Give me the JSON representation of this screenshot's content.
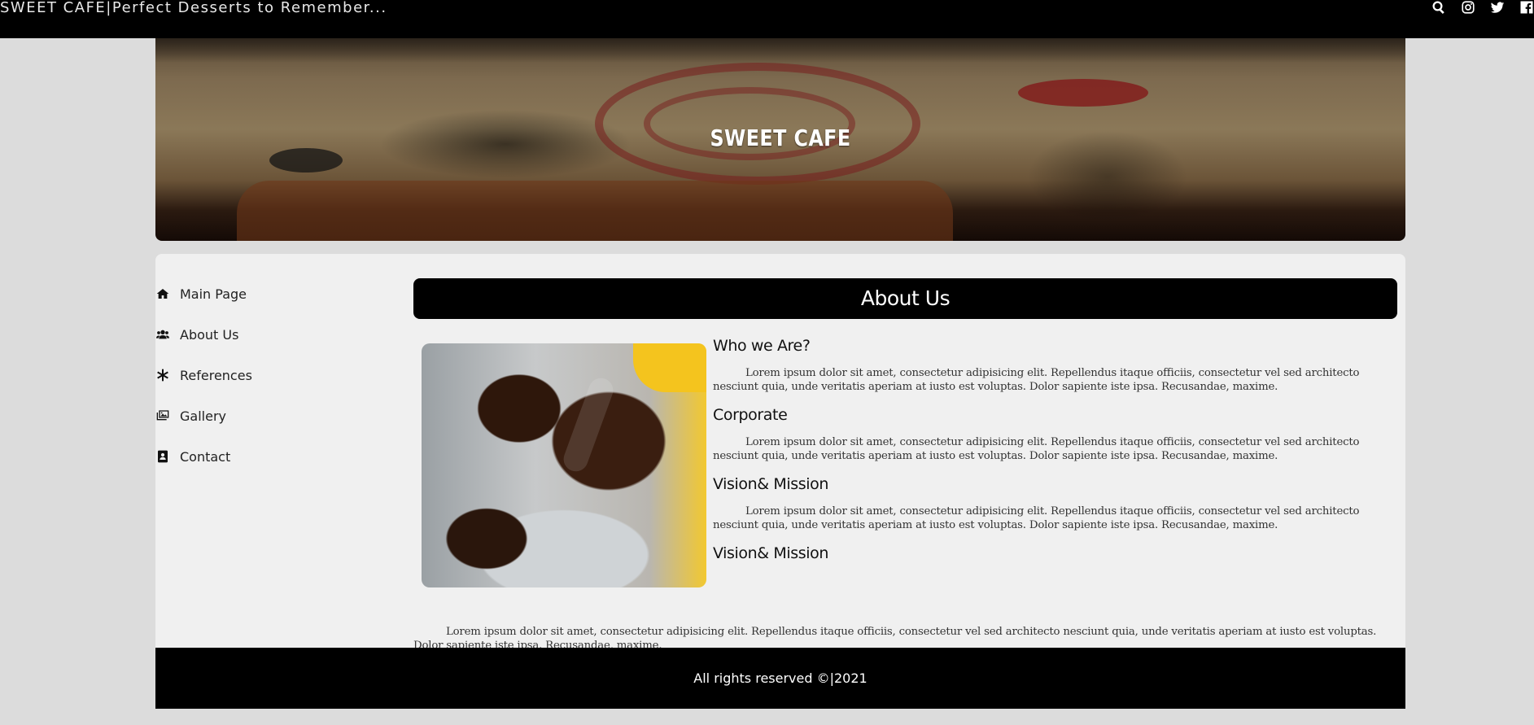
{
  "topbar": {
    "brand": "SWEET CAFE|Perfect Desserts to Remember...",
    "icons": [
      "search-icon",
      "instagram-icon",
      "twitter-icon",
      "facebook-icon"
    ]
  },
  "hero": {
    "title": "SWEET CAFE"
  },
  "nav": {
    "items": [
      {
        "label": "Main Page",
        "icon": "home-icon"
      },
      {
        "label": "About Us",
        "icon": "users-icon"
      },
      {
        "label": "References",
        "icon": "asterisk-icon"
      },
      {
        "label": "Gallery",
        "icon": "images-icon"
      },
      {
        "label": "Contact",
        "icon": "contact-card-icon"
      }
    ]
  },
  "main": {
    "heading": "About Us",
    "sections": [
      {
        "title": "Who we Are?",
        "text": "Lorem ipsum dolor sit amet, consectetur adipisicing elit. Repellendus itaque officiis, consectetur vel sed architecto nesciunt quia, unde veritatis aperiam at iusto est voluptas. Dolor sapiente iste ipsa. Recusandae, maxime."
      },
      {
        "title": "Corporate",
        "text": "Lorem ipsum dolor sit amet, consectetur adipisicing elit. Repellendus itaque officiis, consectetur vel sed architecto nesciunt quia, unde veritatis aperiam at iusto est voluptas. Dolor sapiente iste ipsa. Recusandae, maxime."
      },
      {
        "title": "Vision& Mission",
        "text": "Lorem ipsum dolor sit amet, consectetur adipisicing elit. Repellendus itaque officiis, consectetur vel sed architecto nesciunt quia, unde veritatis aperiam at iusto est voluptas. Dolor sapiente iste ipsa. Recusandae, maxime."
      },
      {
        "title": "Vision& Mission",
        "text": "Lorem ipsum dolor sit amet, consectetur adipisicing elit. Repellendus itaque officiis, consectetur vel sed architecto nesciunt quia, unde veritatis aperiam at iusto est voluptas. Dolor sapiente iste ipsa. Recusandae, maxime."
      }
    ]
  },
  "footer": {
    "text": "All rights reserved ©|2021"
  }
}
